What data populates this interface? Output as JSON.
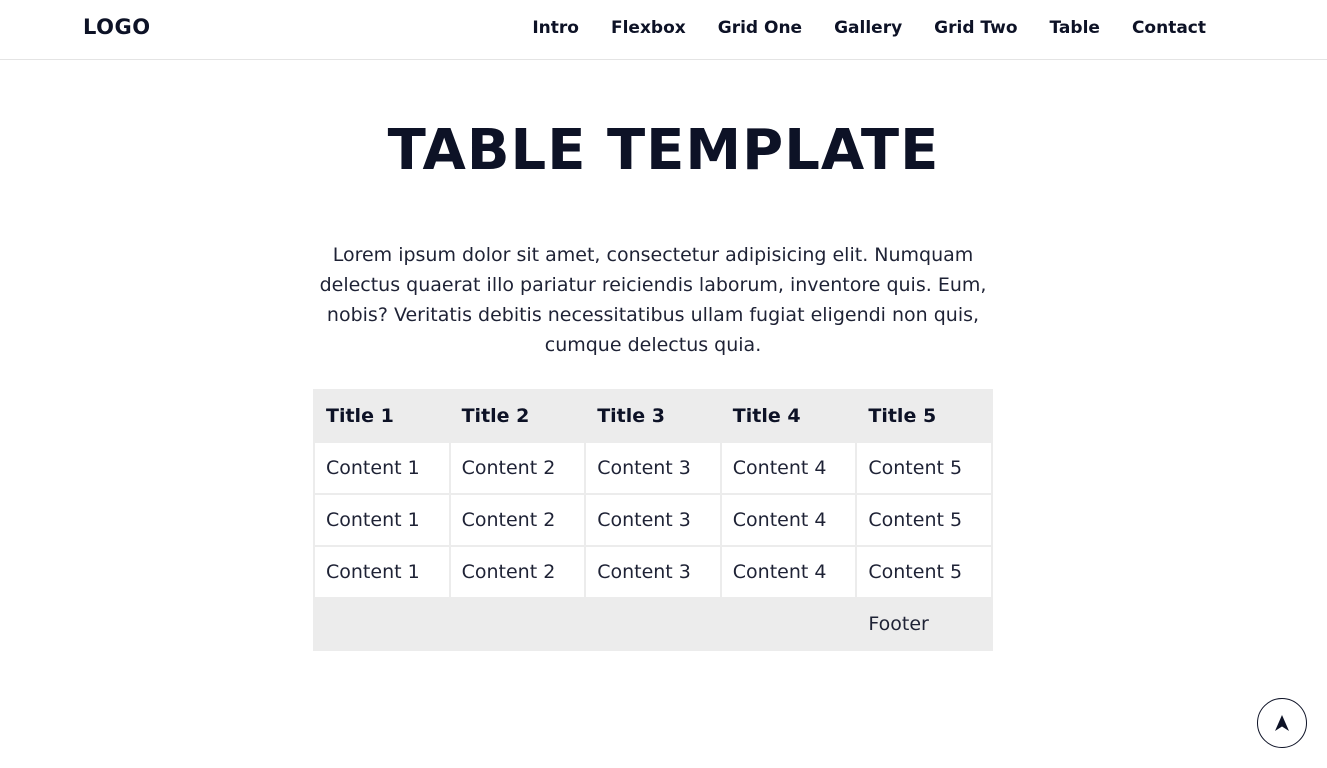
{
  "header": {
    "logo": "LOGO",
    "nav": [
      "Intro",
      "Flexbox",
      "Grid One",
      "Gallery",
      "Grid Two",
      "Table",
      "Contact"
    ]
  },
  "main": {
    "title": "TABLE TEMPLATE",
    "intro": "Lorem ipsum dolor sit amet, consectetur adipisicing elit. Numquam delectus quaerat illo pariatur reiciendis laborum, inventore quis. Eum, nobis? Veritatis debitis necessitatibus ullam fugiat eligendi non quis, cumque delectus quia."
  },
  "table": {
    "headers": [
      "Title 1",
      "Title 2",
      "Title 3",
      "Title 4",
      "Title 5"
    ],
    "rows": [
      [
        "Content 1",
        "Content 2",
        "Content 3",
        "Content 4",
        "Content 5"
      ],
      [
        "Content 1",
        "Content 2",
        "Content 3",
        "Content 4",
        "Content 5"
      ],
      [
        "Content 1",
        "Content 2",
        "Content 3",
        "Content 4",
        "Content 5"
      ]
    ],
    "footer": "Footer"
  },
  "scroll_top": {
    "icon": "arrow-up-icon"
  },
  "colors": {
    "text": "#0d1226",
    "table_header_bg": "#ececec",
    "border": "#ececec"
  }
}
